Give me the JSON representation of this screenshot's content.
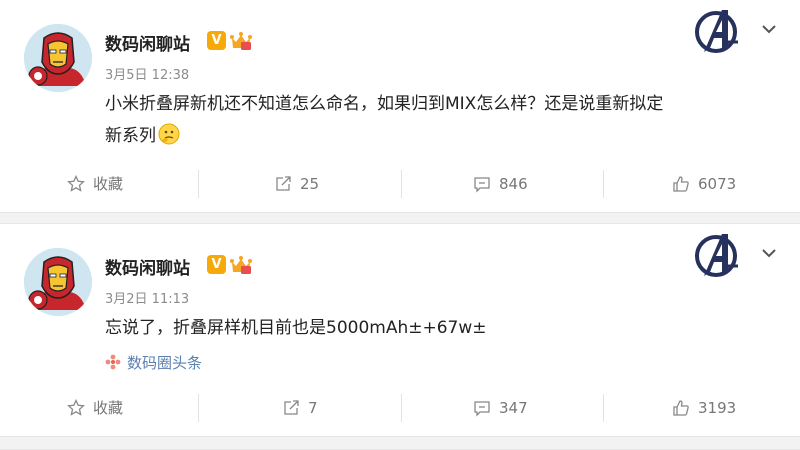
{
  "posts": [
    {
      "username": "数码闲聊站",
      "verified_label": "V",
      "time": "3月5日 12:38",
      "content": "小米折叠屏新机还不知道怎么命名，如果归到MIX怎么样？还是说重新拟定新系列",
      "source": "",
      "actions": {
        "favorite": "收藏",
        "repost": "25",
        "comment": "846",
        "like": "6073"
      }
    },
    {
      "username": "数码闲聊站",
      "verified_label": "V",
      "time": "3月2日 11:13",
      "content": "忘说了，折叠屏样机目前也是5000mAh±+67w±",
      "source": "数码圈头条",
      "actions": {
        "favorite": "收藏",
        "repost": "7",
        "comment": "347",
        "like": "3193"
      }
    }
  ],
  "icons": {
    "avatar": "iron-man-avatar",
    "badge": "verified-v-icon",
    "member": "crown-member-icon",
    "team": "avengers-logo-icon",
    "menu": "chevron-down-icon",
    "favorite": "star-icon",
    "repost": "repost-icon",
    "comment": "comment-icon",
    "like": "thumb-up-icon",
    "emoji": "thinking-emoji-icon",
    "source": "topic-flower-icon"
  },
  "colors": {
    "badge": "#f7a90a",
    "link": "#5b7fb0",
    "separator": "#f2f2f2"
  }
}
